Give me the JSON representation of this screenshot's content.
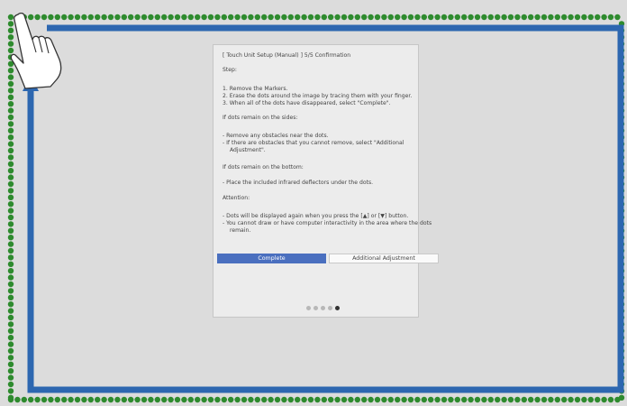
{
  "dialog": {
    "title": "[ Touch Unit Setup (Manual) ]  5/5 Confirmation",
    "step_heading": "Step:",
    "steps": [
      "1. Remove the Markers.",
      "2. Erase the dots around the image by tracing them with your finger.",
      "3. When all of the dots have disappeared, select \"Complete\"."
    ],
    "sides_heading": "If dots remain on the sides:",
    "sides_items": [
      "- Remove any obstacles near the dots.",
      "- If there are obstacles that you cannot remove, select \"Additional",
      "Adjustment\"."
    ],
    "bottom_heading": "If dots remain on the bottom:",
    "bottom_items": [
      "- Place the included infrared deflectors under the dots."
    ],
    "attention_heading": "Attention:",
    "attention_items": [
      "- Dots will be displayed again when you press the [▲] or [▼] button.",
      "- You cannot draw or have computer interactivity in the area where the dots",
      "remain."
    ],
    "buttons": {
      "complete": "Complete",
      "additional": "Additional Adjustment"
    },
    "pager": {
      "total": 5,
      "current": 5
    }
  },
  "colors": {
    "dots": "#2e8b2e",
    "trace_arrow": "#2d67b0",
    "primary_button": "#4a6fbf",
    "background": "#dcdcdc"
  },
  "icons": [
    "pointing-hand-icon",
    "trace-arrow-icon"
  ]
}
